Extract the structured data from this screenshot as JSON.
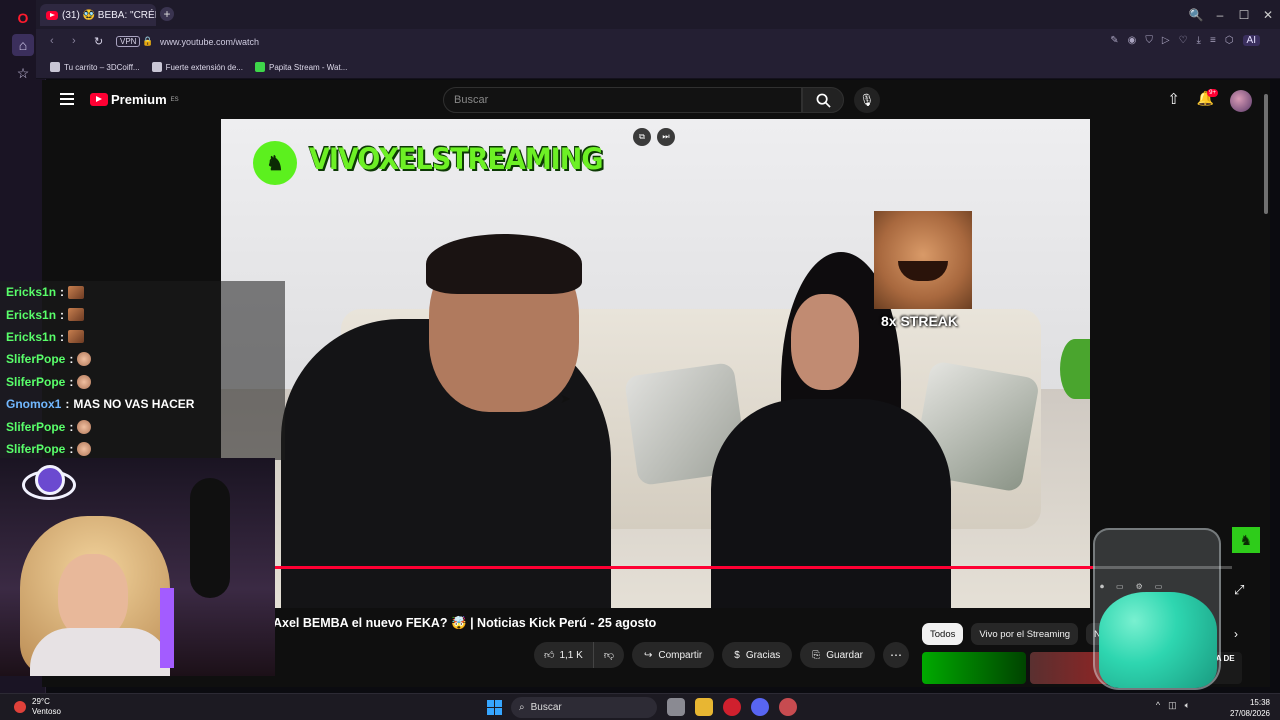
{
  "browser": {
    "tab_title": "(31) 🥸 BEBA: \"CRÉEM",
    "new_tab": "+",
    "url": "www.youtube.com/watch",
    "vpn_label": "VPN",
    "ai_label": "AI",
    "window_controls": [
      "🔍",
      "–",
      "☐",
      "✕"
    ]
  },
  "bookmarks": [
    {
      "label": "Tu carrito – 3DCoiff...",
      "icon": "bookmark-icon"
    },
    {
      "label": "Fuerte extensión de...",
      "icon": "bookmark-icon"
    },
    {
      "label": "Papita Stream - Wat...",
      "icon": "kick-icon"
    }
  ],
  "youtube": {
    "logo_text": "Premium",
    "logo_region": "ES",
    "search_placeholder": "Buscar",
    "notifications_badge": "9+",
    "video_title": "Axel BEMBA el nuevo FEKA? 🤯 | Noticias Kick Perú - 25 agosto",
    "actions": {
      "likes": "1,1 K",
      "share": "Compartir",
      "thanks": "Gracias",
      "save": "Guardar"
    },
    "chips": [
      "Todos",
      "Vivo por el Streaming",
      "N"
    ],
    "rec_text": "DA DE",
    "progress_fraction": 0.855
  },
  "video_overlay": {
    "channel_name": "VIVOXELSTREAMING",
    "streak_text": "8x STREAK"
  },
  "chat": [
    {
      "user": "Ericks1n",
      "message": "",
      "emote": "square"
    },
    {
      "user": "Ericks1n",
      "message": "",
      "emote": "square"
    },
    {
      "user": "Ericks1n",
      "message": "",
      "emote": "square"
    },
    {
      "user": "SliferPope",
      "message": "",
      "emote": "round"
    },
    {
      "user": "SliferPope",
      "message": "",
      "emote": "round"
    },
    {
      "user": "Gnomox1",
      "message": "MAS NO VAS HACER",
      "emote": ""
    },
    {
      "user": "SliferPope",
      "message": "",
      "emote": "round"
    },
    {
      "user": "SliferPope",
      "message": "",
      "emote": "round"
    }
  ],
  "taskbar": {
    "temperature": "29°C",
    "weather": "Ventoso",
    "search": "Buscar",
    "time": "15:38",
    "date": "27/08/2026"
  },
  "colors": {
    "youtube_red": "#ff0033",
    "kick_green": "#53fc18",
    "chat_user_green": "#59ff6a"
  }
}
